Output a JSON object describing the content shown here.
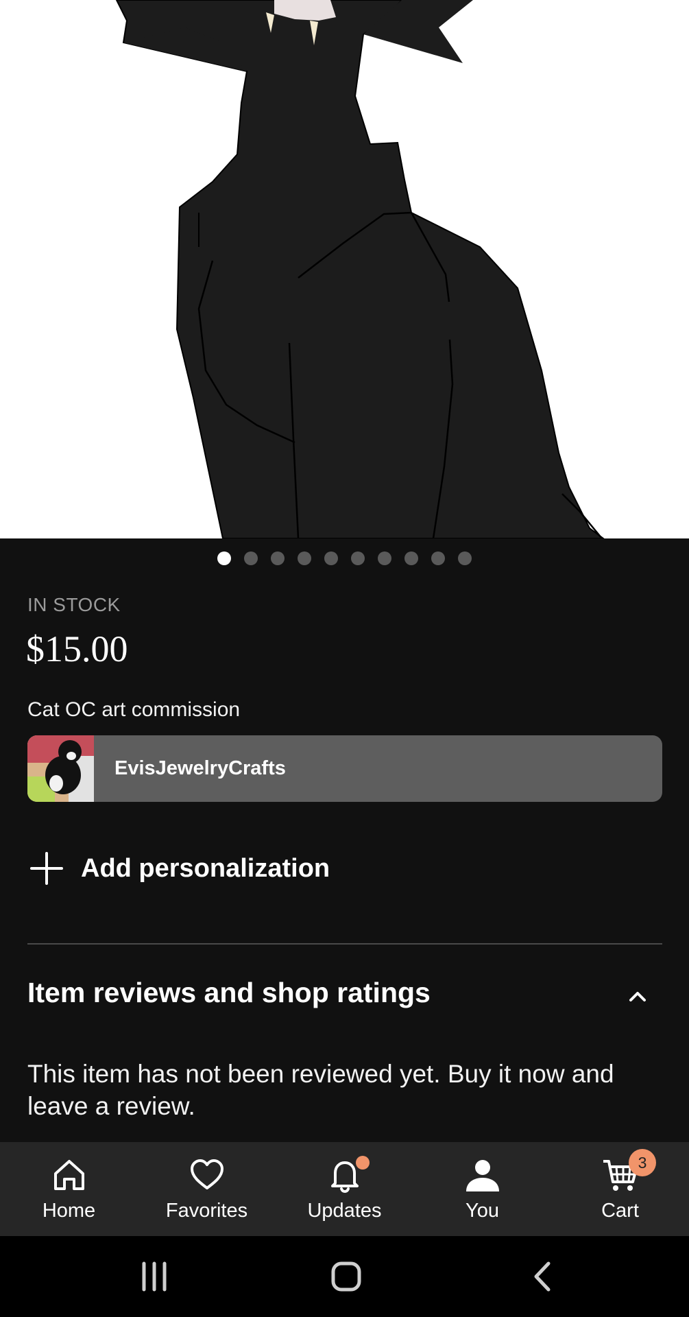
{
  "product": {
    "gallery_count": 10,
    "gallery_active_index": 0,
    "stock_status": "IN STOCK",
    "price": "$15.00",
    "title": "Cat OC art commission",
    "shop_name": "EvisJewelryCrafts"
  },
  "personalization": {
    "label": "Add personalization"
  },
  "reviews": {
    "heading": "Item reviews and shop ratings",
    "empty_text": "This item has not been reviewed yet. Buy it now and leave a review."
  },
  "tabbar": {
    "items": [
      {
        "label": "Home",
        "icon": "home-icon"
      },
      {
        "label": "Favorites",
        "icon": "heart-icon"
      },
      {
        "label": "Updates",
        "icon": "bell-icon"
      },
      {
        "label": "You",
        "icon": "person-icon"
      },
      {
        "label": "Cart",
        "icon": "cart-icon"
      }
    ],
    "cart_count": "3"
  },
  "colors": {
    "badge": "#f1946a",
    "background": "#111111",
    "tabbar": "#262626"
  }
}
